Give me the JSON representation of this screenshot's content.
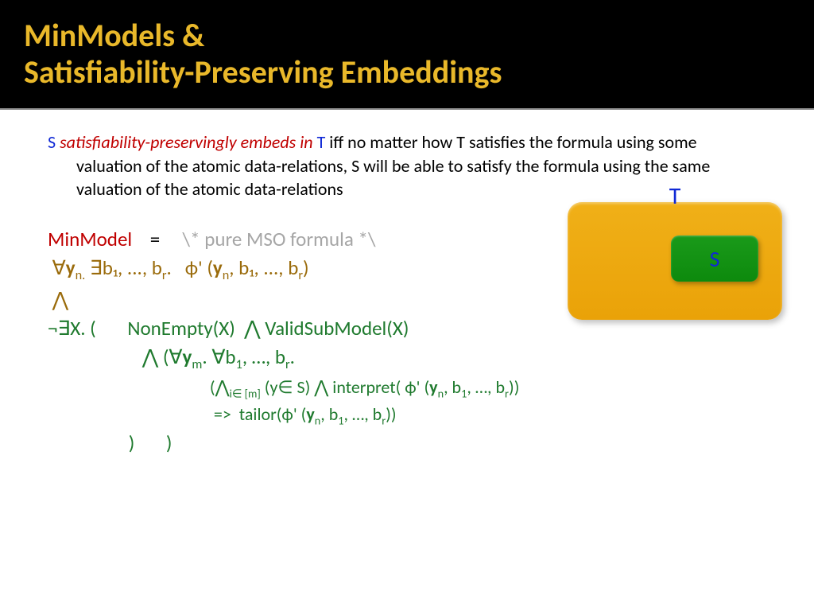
{
  "title": {
    "line1": "MinModels &",
    "line2": "Satisfiability-Preserving Embeddings"
  },
  "para": {
    "s": "S",
    "embeds": " satisfiability-preservingly embeds ",
    "in": "in ",
    "t": "T",
    "rest": " iff no matter how T satisfies the formula using some valuation of the atomic data-relations, S will be able to satisfy the formula using the same valuation of the atomic data-relations"
  },
  "formula": {
    "minmodel": "MinModel",
    "eq": "    =     ",
    "comment": "\\* pure MSO formula *\\",
    "line2_a": " ∀",
    "line2_b": "y",
    "line2_c": "n.",
    "line2_d": " ∃b",
    "line2_e": "₁",
    "line2_f": ", ..., b",
    "line2_g": "r",
    "line2_h": ".   ϕ' (",
    "line2_i": "y",
    "line2_j": "n",
    "line2_k": ", b",
    "line2_l": "₁",
    "line2_m": ", ..., b",
    "line2_n": "r",
    "line2_o": ")",
    "and": " ⋀",
    "l4": "¬∃X. (       NonEmpty(X)  ⋀ ValidSubModel(X)",
    "l5_a": "                     ⋀ (∀",
    "l5_b": "y",
    "l5_c": "m",
    "l5_d": ". ∀b",
    "l5_e": "1",
    "l5_f": ", …, b",
    "l5_g": "r",
    "l5_h": ".",
    "l6_a": "                                         (⋀",
    "l6_b": "i∈ [m]",
    "l6_c": " (y∈ S) ⋀ interpret( ϕ' (",
    "l6_d": "y",
    "l6_e": "n",
    "l6_f": ", b",
    "l6_g": "1",
    "l6_h": ", …, b",
    "l6_i": "r",
    "l6_j": "))",
    "l7_a": "                                          =>  tailor(ϕ' (",
    "l7_b": "y",
    "l7_c": "n",
    "l7_d": ", b",
    "l7_e": "1",
    "l7_f": ", …, b",
    "l7_g": "r",
    "l7_h": "))",
    "l8": "                  )       )"
  },
  "diagram": {
    "outer": "T",
    "inner": "S"
  }
}
